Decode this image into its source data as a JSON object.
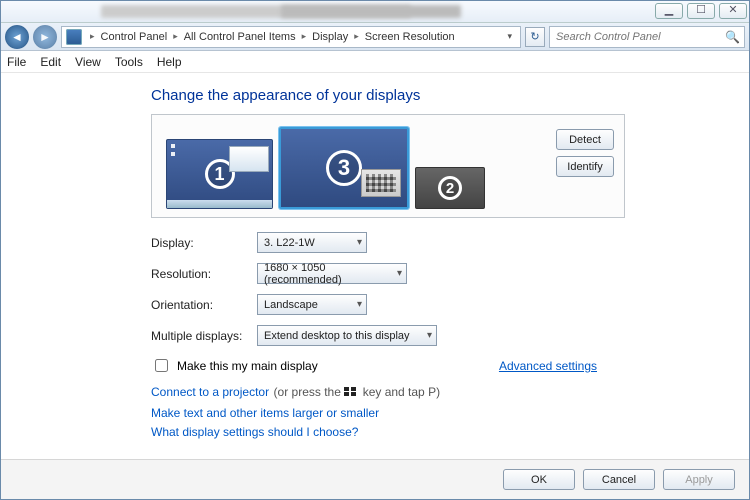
{
  "window": {
    "min": "▁",
    "max": "☐",
    "close": "✕"
  },
  "breadcrumb": {
    "c0": "Control Panel",
    "c1": "All Control Panel Items",
    "c2": "Display",
    "c3": "Screen Resolution",
    "sep": "▸",
    "drop": "▾"
  },
  "search": {
    "placeholder": "Search Control Panel"
  },
  "menu": {
    "file": "File",
    "edit": "Edit",
    "view": "View",
    "tools": "Tools",
    "help": "Help"
  },
  "heading": "Change the appearance of your displays",
  "monitors": {
    "m1": "1",
    "m2": "2",
    "m3": "3"
  },
  "buttons": {
    "detect": "Detect",
    "identify": "Identify",
    "ok": "OK",
    "cancel": "Cancel",
    "apply": "Apply"
  },
  "labels": {
    "display": "Display:",
    "resolution": "Resolution:",
    "orientation": "Orientation:",
    "multiple": "Multiple displays:"
  },
  "values": {
    "display": "3. L22-1W",
    "resolution": "1680 × 1050 (recommended)",
    "orientation": "Landscape",
    "multiple": "Extend desktop to this display"
  },
  "checkbox": {
    "label": "Make this my main display"
  },
  "advanced": "Advanced settings",
  "links": {
    "projector_a": "Connect to a projector",
    "projector_b": " (or press the ",
    "projector_c": " key and tap P)",
    "textsize": "Make text and other items larger or smaller",
    "help": "What display settings should I choose?"
  }
}
